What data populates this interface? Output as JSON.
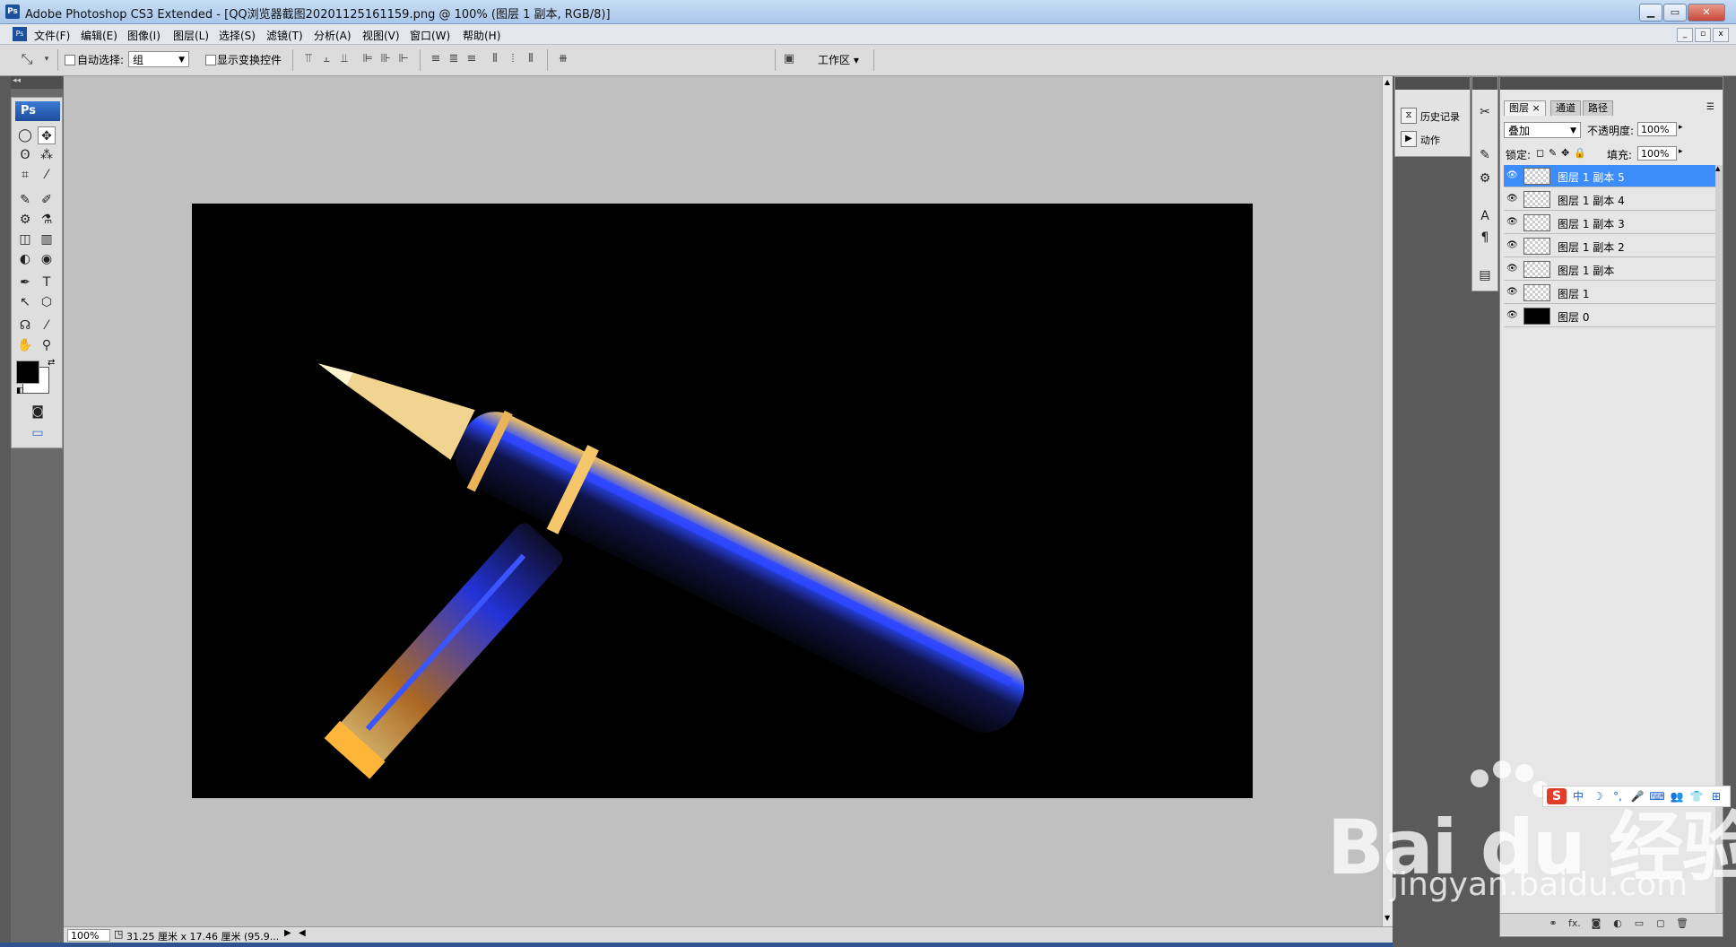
{
  "window": {
    "title": "Adobe Photoshop CS3 Extended - [QQ浏览器截图20201125161159.png @ 100% (图层 1 副本, RGB/8)]",
    "app_badge": "Ps",
    "minimize": "▁",
    "maximize": "▭",
    "close": "✕"
  },
  "menu": {
    "items": [
      "文件(F)",
      "编辑(E)",
      "图像(I)",
      "图层(L)",
      "选择(S)",
      "滤镜(T)",
      "分析(A)",
      "视图(V)",
      "窗口(W)",
      "帮助(H)"
    ]
  },
  "options_bar": {
    "auto_select_label": "自动选择:",
    "auto_select_value": "组",
    "show_transform_label": "显示变换控件",
    "workspace_label": "工作区 ▾"
  },
  "toolbox": {
    "brand": "Ps",
    "tools": [
      "◯",
      "✥",
      "ʘ",
      "⁂",
      "⌗",
      "⁄",
      "✎",
      "✐",
      "⚙",
      "⚗",
      "◫",
      "▥",
      "◐",
      "◉",
      "✒",
      "T",
      "↖",
      "⬡",
      "☊",
      "⁄",
      "✋",
      "⚲"
    ]
  },
  "status": {
    "zoom": "100%",
    "doc_info": "31.25 厘米 x 17.46 厘米 (95.9..."
  },
  "dock": {
    "history_label": "历史记录",
    "actions_label": "动作"
  },
  "layers_panel": {
    "tabs": [
      "图层",
      "通道",
      "路径"
    ],
    "tab_close": "×",
    "blend_mode": "叠加",
    "opacity_label": "不透明度:",
    "opacity_value": "100%",
    "lock_label": "锁定:",
    "fill_label": "填充:",
    "fill_value": "100%",
    "layers": [
      {
        "name": "图层 1 副本 5",
        "selected": true,
        "thumb": "transparent"
      },
      {
        "name": "图层 1 副本 4",
        "selected": false,
        "thumb": "transparent"
      },
      {
        "name": "图层 1 副本 3",
        "selected": false,
        "thumb": "transparent"
      },
      {
        "name": "图层 1 副本 2",
        "selected": false,
        "thumb": "transparent"
      },
      {
        "name": "图层 1 副本",
        "selected": false,
        "thumb": "transparent"
      },
      {
        "name": "图层 1",
        "selected": false,
        "thumb": "transparent"
      },
      {
        "name": "图层 0",
        "selected": false,
        "thumb": "black"
      }
    ],
    "footer_icons": [
      "⚭",
      "fx.",
      "◙",
      "◐",
      "▭",
      "◻",
      "🗑"
    ]
  },
  "ime": {
    "badge": "S",
    "icons": [
      "中",
      "☽",
      "°,",
      "🎤",
      "⌨",
      "👥",
      "👕",
      "⊞"
    ]
  },
  "watermark": {
    "logo": "Bai du 经验",
    "url": "jingyan.baidu.com"
  },
  "colors": {
    "selection": "#3c8dfb",
    "canvas_bg": "#c0c0c0",
    "pen_blue": "#1f3cff",
    "pen_gold": "#f0b33a"
  }
}
